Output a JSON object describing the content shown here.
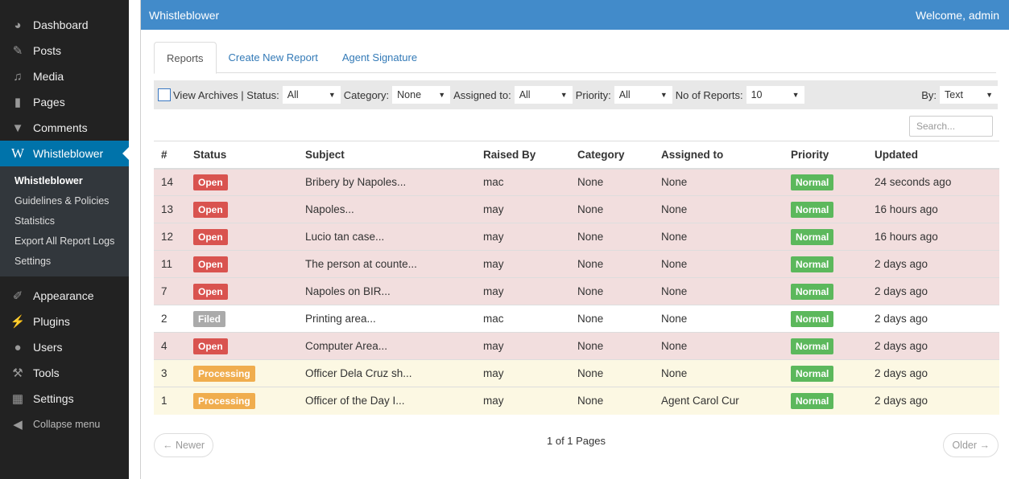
{
  "sidebar": {
    "top_items": [
      {
        "label": "Dashboard",
        "icon": "dashboard-icon"
      },
      {
        "label": "Posts",
        "icon": "pin-icon"
      },
      {
        "label": "Media",
        "icon": "media-icon"
      },
      {
        "label": "Pages",
        "icon": "pages-icon"
      },
      {
        "label": "Comments",
        "icon": "comment-icon"
      }
    ],
    "active": {
      "label": "Whistleblower",
      "icon": "w-icon"
    },
    "submenu": [
      "Whistleblower",
      "Guidelines & Policies",
      "Statistics",
      "Export All Report Logs",
      "Settings"
    ],
    "bottom_items": [
      {
        "label": "Appearance",
        "icon": "brush-icon"
      },
      {
        "label": "Plugins",
        "icon": "plug-icon"
      },
      {
        "label": "Users",
        "icon": "user-icon"
      },
      {
        "label": "Tools",
        "icon": "wrench-icon"
      },
      {
        "label": "Settings",
        "icon": "settings-icon"
      }
    ],
    "collapse": "Collapse menu"
  },
  "header": {
    "title": "Whistleblower",
    "welcome": "Welcome, admin"
  },
  "tabs": [
    "Reports",
    "Create New Report",
    "Agent Signature"
  ],
  "filters": {
    "view_archives": "View Archives | Status:",
    "status": "All",
    "category_label": "Category:",
    "category": "None",
    "assigned_label": "Assigned to:",
    "assigned": "All",
    "priority_label": "Priority:",
    "priority": "All",
    "count_label": "No of Reports:",
    "count": "10",
    "by_label": "By:",
    "by": "Text"
  },
  "search": {
    "placeholder": "Search..."
  },
  "table": {
    "headers": [
      "#",
      "Status",
      "Subject",
      "Raised By",
      "Category",
      "Assigned to",
      "Priority",
      "Updated"
    ],
    "rows": [
      {
        "id": "14",
        "status": "Open",
        "subject": "Bribery by Napoles...",
        "raised_by": "mac",
        "category": "None",
        "assigned": "None",
        "priority": "Normal",
        "updated": "24 seconds ago"
      },
      {
        "id": "13",
        "status": "Open",
        "subject": "Napoles...",
        "raised_by": "may",
        "category": "None",
        "assigned": "None",
        "priority": "Normal",
        "updated": "16 hours ago"
      },
      {
        "id": "12",
        "status": "Open",
        "subject": "Lucio tan case...",
        "raised_by": "may",
        "category": "None",
        "assigned": "None",
        "priority": "Normal",
        "updated": "16 hours ago"
      },
      {
        "id": "11",
        "status": "Open",
        "subject": "The person at counte...",
        "raised_by": "may",
        "category": "None",
        "assigned": "None",
        "priority": "Normal",
        "updated": "2 days ago"
      },
      {
        "id": "7",
        "status": "Open",
        "subject": "Napoles on BIR...",
        "raised_by": "may",
        "category": "None",
        "assigned": "None",
        "priority": "Normal",
        "updated": "2 days ago"
      },
      {
        "id": "2",
        "status": "Filed",
        "subject": "Printing area...",
        "raised_by": "mac",
        "category": "None",
        "assigned": "None",
        "priority": "Normal",
        "updated": "2 days ago"
      },
      {
        "id": "4",
        "status": "Open",
        "subject": "Computer Area...",
        "raised_by": "may",
        "category": "None",
        "assigned": "None",
        "priority": "Normal",
        "updated": "2 days ago"
      },
      {
        "id": "3",
        "status": "Processing",
        "subject": "Officer Dela Cruz sh...",
        "raised_by": "may",
        "category": "None",
        "assigned": "None",
        "priority": "Normal",
        "updated": "2 days ago"
      },
      {
        "id": "1",
        "status": "Processing",
        "subject": "Officer of the Day I...",
        "raised_by": "may",
        "category": "None",
        "assigned": "Agent Carol Cur",
        "priority": "Normal",
        "updated": "2 days ago"
      }
    ]
  },
  "pagination": {
    "newer": "← Newer",
    "info": "1 of 1 Pages",
    "older": "Older →"
  },
  "colors": {
    "accent": "#428bca",
    "sidebar": "#222222",
    "active_menu": "#0073aa",
    "open": "#d9534f",
    "processing": "#f0ad4e",
    "normal": "#5cb85c",
    "filed": "#aaaaaa"
  }
}
